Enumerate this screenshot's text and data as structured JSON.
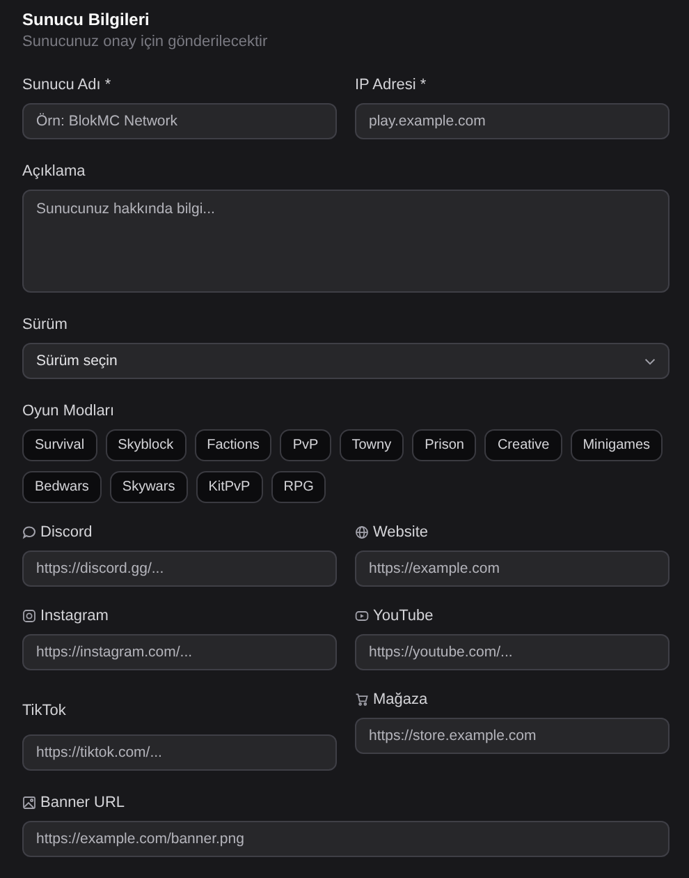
{
  "section": {
    "title": "Sunucu Bilgileri",
    "subtitle": "Sunucunuz onay için gönderilecektir"
  },
  "name_field": {
    "label": "Sunucu Adı *",
    "placeholder": "Örn: BlokMC Network"
  },
  "ip_field": {
    "label": "IP Adresi *",
    "placeholder": "play.example.com"
  },
  "description": {
    "label": "Açıklama",
    "placeholder": "Sunucunuz hakkında bilgi..."
  },
  "version": {
    "label": "Sürüm",
    "placeholder": "Sürüm seçin"
  },
  "game_modes": {
    "label": "Oyun Modları",
    "modes": [
      {
        "label": "Survival",
        "selected": false
      },
      {
        "label": "Skyblock",
        "selected": false
      },
      {
        "label": "Factions",
        "selected": false
      },
      {
        "label": "PvP",
        "selected": false
      },
      {
        "label": "Towny",
        "selected": false
      },
      {
        "label": "Prison",
        "selected": false
      },
      {
        "label": "Creative",
        "selected": false
      },
      {
        "label": "Minigames",
        "selected": false
      },
      {
        "label": "Bedwars",
        "selected": false
      },
      {
        "label": "Skywars",
        "selected": false
      },
      {
        "label": "KitPvP",
        "selected": false
      },
      {
        "label": "RPG",
        "selected": false
      }
    ]
  },
  "links": [
    {
      "label": "Discord",
      "kind": "chat",
      "placeholder": "https://discord.gg/..."
    },
    {
      "label": "Website",
      "kind": "globe",
      "placeholder": "https://example.com"
    },
    {
      "label": "Instagram",
      "kind": "camera",
      "placeholder": "https://instagram.com/..."
    },
    {
      "label": "YouTube",
      "kind": "play",
      "placeholder": "https://youtube.com/..."
    },
    {
      "label": "TikTok",
      "kind": "plain",
      "placeholder": "https://tiktok.com/..."
    },
    {
      "label": "Mağaza",
      "kind": "cart",
      "placeholder": "https://store.example.com"
    }
  ],
  "banner": {
    "label": "Banner URL",
    "kind": "image",
    "placeholder": "https://example.com/banner.png"
  }
}
